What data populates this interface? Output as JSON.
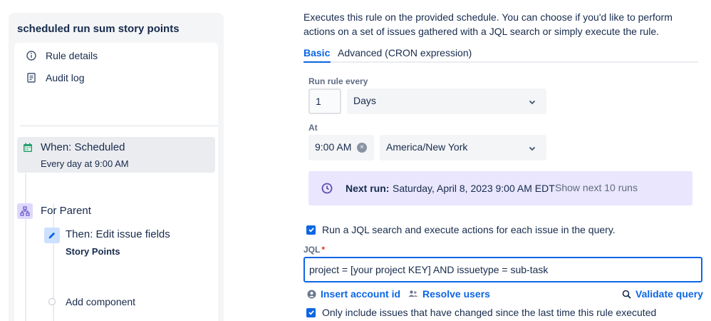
{
  "left": {
    "rule_title": "scheduled run sum story points",
    "nav": {
      "rule_details": "Rule details",
      "audit_log": "Audit log"
    },
    "trigger": {
      "title": "When: Scheduled",
      "subtitle": "Every day at 9:00 AM"
    },
    "branch": {
      "title": "For Parent"
    },
    "action": {
      "title": "Then: Edit issue fields",
      "subtitle": "Story Points"
    },
    "add_component": "Add component"
  },
  "right": {
    "description": "Executes this rule on the provided schedule. You can choose if you'd like to perform actions on a set of issues gathered with a JQL search or simply execute the rule.",
    "tabs": [
      {
        "label": "Basic",
        "active": true
      },
      {
        "label": "Advanced (CRON expression)",
        "active": false
      }
    ],
    "run_every": {
      "label": "Run rule every",
      "value": "1",
      "unit": "Days"
    },
    "at": {
      "label": "At",
      "time": "9:00 AM",
      "timezone": "America/New York"
    },
    "next_run": {
      "label": "Next run:",
      "value": "Saturday, April 8, 2023 9:00 AM EDT",
      "show_more": "Show next 10 runs"
    },
    "jql_checkbox": {
      "label": "Run a JQL search and execute actions for each issue in the query.",
      "checked": true
    },
    "jql": {
      "label": "JQL",
      "required_mark": "*",
      "value": "project = [your project KEY] AND issuetype = sub-task"
    },
    "links": {
      "insert_account_id": "Insert account id",
      "resolve_users": "Resolve users",
      "validate_query": "Validate query"
    },
    "changed_checkbox": {
      "label": "Only include issues that have changed since the last time this rule executed",
      "checked": true
    }
  },
  "colors": {
    "accent": "#0c66e4",
    "next_run_bg": "#e9e6fd",
    "trigger_icon": "#22a06b",
    "branch_icon": "#6e5dc6"
  }
}
